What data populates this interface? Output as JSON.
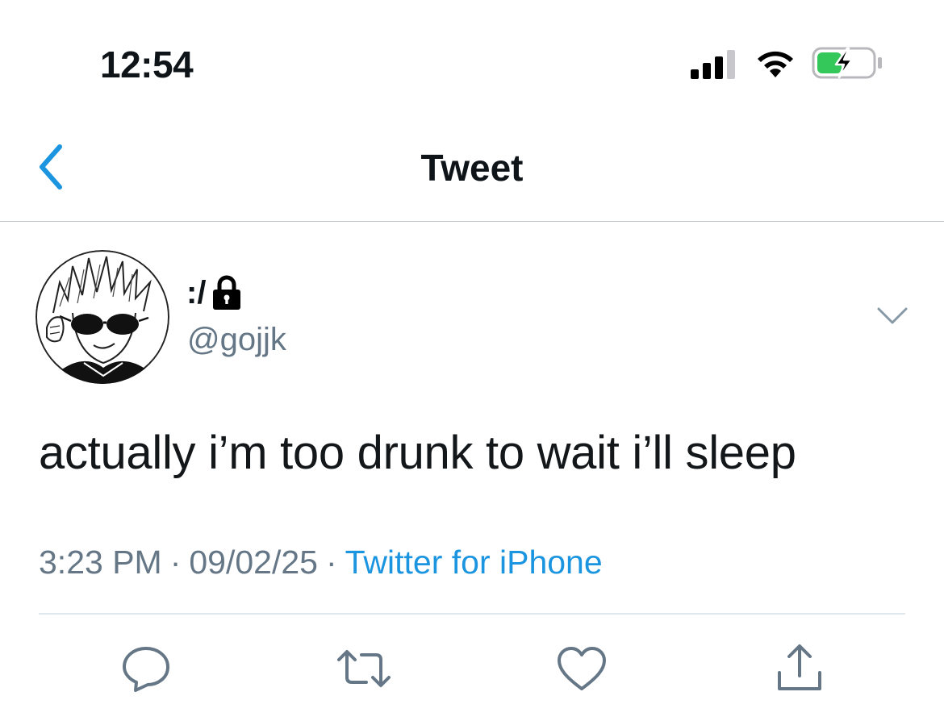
{
  "status_bar": {
    "time": "12:54",
    "icons": [
      "signal-icon",
      "wifi-icon",
      "battery-charging-icon"
    ],
    "battery_color": "#34c759"
  },
  "nav": {
    "back_icon": "chevron-left-icon",
    "title": "Tweet",
    "accent_color": "#1b95e0"
  },
  "tweet": {
    "author": {
      "display_name": ":/",
      "protected_icon": "lock-icon",
      "handle": "@gojjk",
      "avatar_icon": "avatar-image"
    },
    "menu_icon": "chevron-down-icon",
    "text": "actually i’m too drunk to wait i’ll sleep",
    "time": "3:23 PM",
    "separator": "·",
    "date": "09/02/25",
    "source": "Twitter for iPhone"
  },
  "actions": [
    {
      "name": "reply-icon"
    },
    {
      "name": "retweet-icon"
    },
    {
      "name": "like-icon"
    },
    {
      "name": "share-icon"
    }
  ],
  "colors": {
    "text_primary": "#14171a",
    "text_secondary": "#657786",
    "link": "#1b95e0",
    "icon": "#657786",
    "divider": "#e1e8ed"
  }
}
